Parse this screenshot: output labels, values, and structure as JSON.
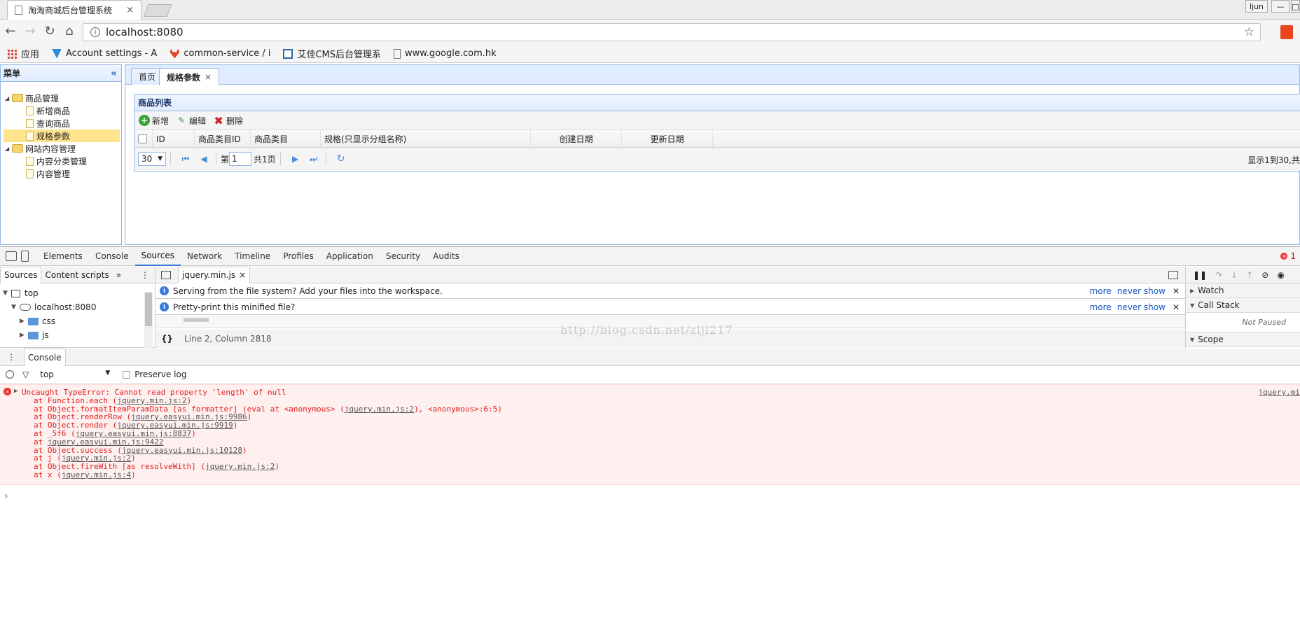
{
  "browser": {
    "tab_title": "淘淘商城后台管理系统",
    "tab_close": "×",
    "user_badge": "ljun",
    "url": "localhost:8080",
    "bookmarks": [
      {
        "label": "应用",
        "icon": "apps-grid-icon"
      },
      {
        "label": "Account settings - A",
        "icon": "account-icon"
      },
      {
        "label": "common-service / i",
        "icon": "gitlab-icon"
      },
      {
        "label": "艾佳CMS后台管理系",
        "icon": "cms-icon"
      },
      {
        "label": "www.google.com.hk",
        "icon": "page-icon"
      }
    ]
  },
  "app": {
    "menu_title": "菜单",
    "tree": [
      {
        "label": "商品管理",
        "type": "folder"
      },
      {
        "label": "新增商品",
        "type": "file"
      },
      {
        "label": "查询商品",
        "type": "file"
      },
      {
        "label": "规格参数",
        "type": "file",
        "selected": true
      },
      {
        "label": "网站内容管理",
        "type": "folder"
      },
      {
        "label": "内容分类管理",
        "type": "file"
      },
      {
        "label": "内容管理",
        "type": "file"
      }
    ],
    "tabs": [
      {
        "label": "首页"
      },
      {
        "label": "规格参数",
        "close": "×"
      }
    ],
    "grid": {
      "title": "商品列表",
      "toolbar": {
        "add": "新增",
        "edit": "编辑",
        "delete": "删除"
      },
      "columns": [
        "ID",
        "商品类目ID",
        "商品类目",
        "规格(只显示分组名称)",
        "创建日期",
        "更新日期"
      ],
      "pager": {
        "page_size": "30",
        "page_label": "第",
        "page_value": "1",
        "total_label": "共1页",
        "info": "显示1到30,共"
      }
    }
  },
  "devtools": {
    "tabs": [
      "Elements",
      "Console",
      "Sources",
      "Network",
      "Timeline",
      "Profiles",
      "Application",
      "Security",
      "Audits"
    ],
    "active_tab": "Sources",
    "error_count": "1",
    "navigator_tabs": [
      "Sources",
      "Content scripts",
      "»"
    ],
    "file_tree": [
      "top",
      "localhost:8080",
      "css",
      "js"
    ],
    "editor_tab": "jquery.min.js",
    "info_bars": [
      {
        "text": "Serving from the file system? Add your files into the workspace.",
        "more": "more",
        "never": "never show"
      },
      {
        "text": "Pretty-print this minified file?",
        "more": "more",
        "never": "never show"
      }
    ],
    "status": "Line 2, Column 2818",
    "status_icon": "{}",
    "debugger_sections": [
      "Watch",
      "Call Stack",
      "Scope"
    ],
    "not_paused": "Not Paused",
    "drawer_tab": "Console",
    "console_context": "top",
    "preserve_log": "Preserve log",
    "error_source": "jquery.mi",
    "error_lines": [
      {
        "text": "Uncaught TypeError: Cannot read property 'length' of null",
        "link": ""
      },
      {
        "text": "at Function.each (",
        "link": "jquery.min.js:2",
        "tail": ")"
      },
      {
        "text": "at Object.formatItemParamData [as formatter] (eval at <anonymous> (",
        "link": "jquery.min.js:2",
        "tail": "), <anonymous>:6:5)"
      },
      {
        "text": "at Object.renderRow (",
        "link": "jquery.easyui.min.js:9986",
        "tail": ")"
      },
      {
        "text": "at Object.render (",
        "link": "jquery.easyui.min.js:9919",
        "tail": ")"
      },
      {
        "text": "at _5f6 (",
        "link": "jquery.easyui.min.js:8837",
        "tail": ")"
      },
      {
        "text": "at ",
        "link": "jquery.easyui.min.js:9422",
        "tail": ""
      },
      {
        "text": "at Object.success (",
        "link": "jquery.easyui.min.js:10128",
        "tail": ")"
      },
      {
        "text": "at j (",
        "link": "jquery.min.js:2",
        "tail": ")"
      },
      {
        "text": "at Object.fireWith [as resolveWith] (",
        "link": "jquery.min.js:2",
        "tail": ")"
      },
      {
        "text": "at x (",
        "link": "jquery.min.js:4",
        "tail": ")"
      }
    ],
    "prompt": "›"
  },
  "watermark": "http://blog.csdn.net/zljl217"
}
